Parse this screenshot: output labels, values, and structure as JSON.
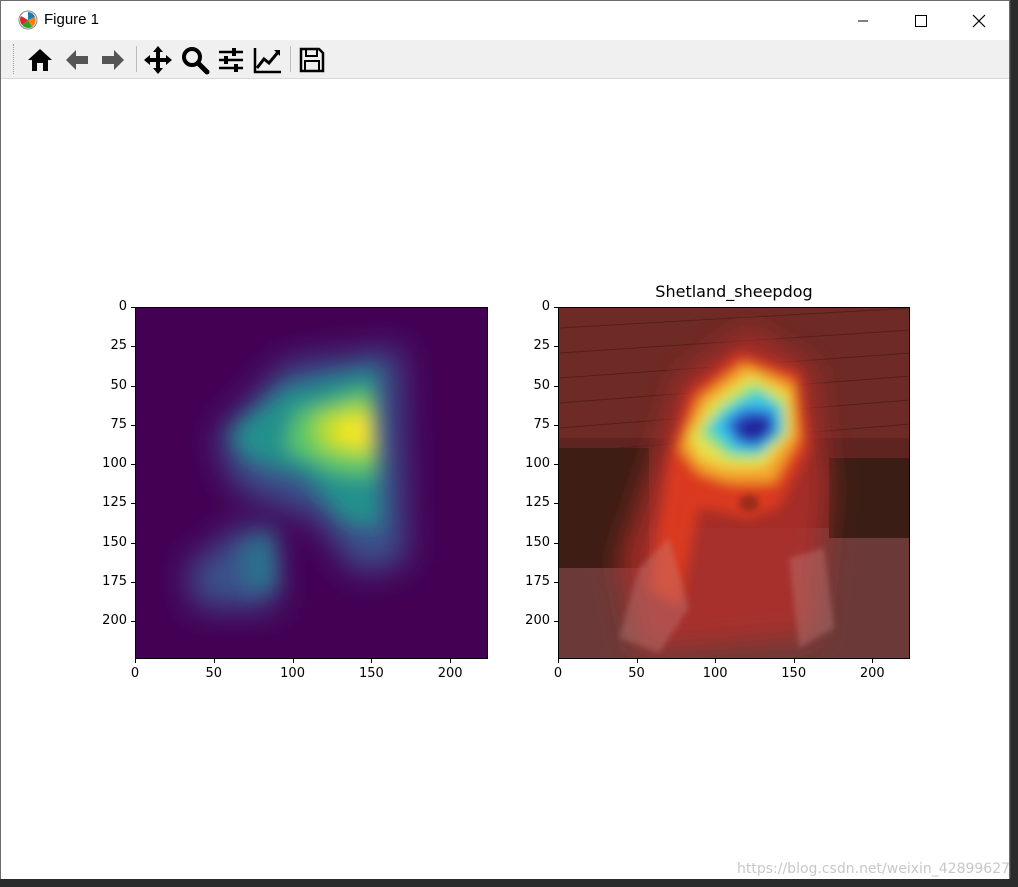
{
  "window": {
    "title": "Figure 1",
    "controls": [
      "minimize",
      "maximize",
      "close"
    ]
  },
  "toolbar": {
    "buttons": [
      {
        "icon": "home-icon"
      },
      {
        "icon": "back-arrow-icon"
      },
      {
        "icon": "forward-arrow-icon"
      },
      {
        "icon": "pan-icon"
      },
      {
        "icon": "zoom-icon"
      },
      {
        "icon": "subplots-config-icon"
      },
      {
        "icon": "edit-axes-icon"
      },
      {
        "icon": "save-icon"
      }
    ]
  },
  "chart_data": [
    {
      "type": "heatmap",
      "title": "",
      "colormap": "viridis",
      "xlim": [
        0,
        224
      ],
      "ylim": [
        224,
        0
      ],
      "x_ticks": [
        "0",
        "50",
        "100",
        "150",
        "200"
      ],
      "y_ticks": [
        "0",
        "25",
        "50",
        "75",
        "100",
        "125",
        "150",
        "175",
        "200"
      ]
    },
    {
      "type": "heatmap",
      "title": "Shetland_sheepdog",
      "colormap": "jet overlay on photo",
      "xlim": [
        0,
        224
      ],
      "ylim": [
        224,
        0
      ],
      "x_ticks": [
        "0",
        "50",
        "100",
        "150",
        "200"
      ],
      "y_ticks": [
        "0",
        "25",
        "50",
        "75",
        "100",
        "125",
        "150",
        "175",
        "200"
      ]
    }
  ],
  "watermark": "https://blog.csdn.net/weixin_42899627",
  "colors": {
    "viridis_low": "#440154",
    "viridis_high": "#fde725",
    "background_ide": "#2b2b2b"
  }
}
